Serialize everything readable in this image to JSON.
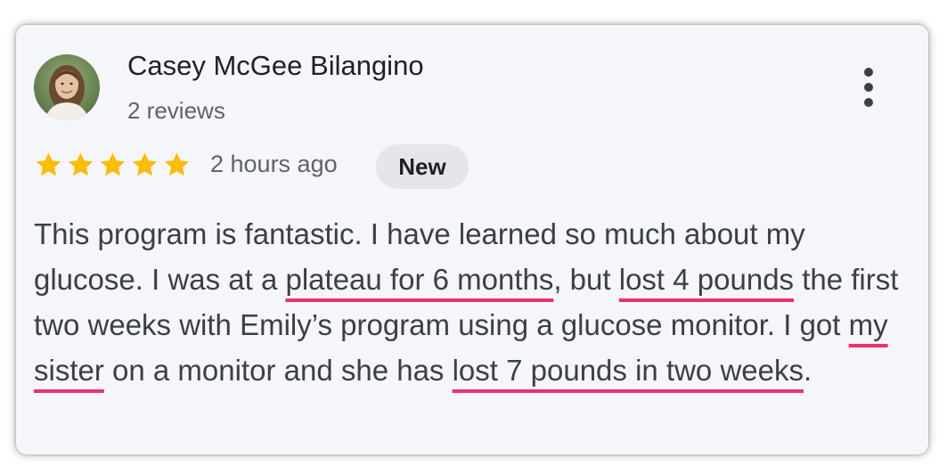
{
  "reviewer": {
    "name": "Casey McGee Bilangino",
    "review_count": "2 reviews",
    "avatar_icon": "person-avatar-icon"
  },
  "rating": {
    "stars": 5,
    "max_stars": 5,
    "star_color": "#fbbc04"
  },
  "timestamp": "2 hours ago",
  "badge": "New",
  "menu_icon": "more-vertical-icon",
  "review": {
    "segments": [
      "This program is fantastic. I have learned so much about my glucose. I was at a ",
      "plateau for 6 months",
      ", but ",
      "lost 4 pounds",
      " the first two weeks with Emily’s program using a glucose monitor. I got ",
      "my sister",
      " on a monitor and she has ",
      "lost 7 pounds in two weeks",
      "."
    ],
    "underline_color": "#e8336d"
  }
}
